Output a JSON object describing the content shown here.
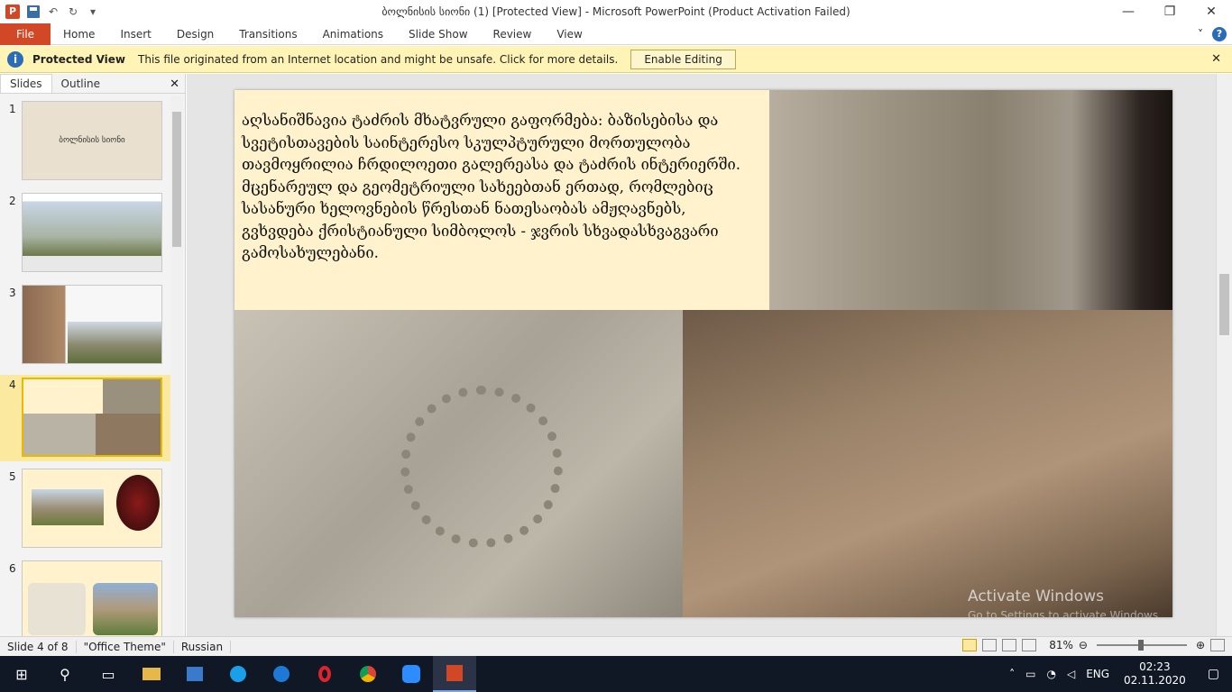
{
  "window": {
    "title": "ბოლნისის სიონი (1) [Protected View]  -  Microsoft PowerPoint (Product Activation Failed)",
    "app_letter": "P",
    "controls": {
      "minimize": "—",
      "restore": "❐",
      "close": "✕"
    }
  },
  "quick_access": {
    "undo": "↶",
    "redo": "↻",
    "customize": "▾"
  },
  "ribbon": {
    "file_label": "File",
    "tabs": [
      "Home",
      "Insert",
      "Design",
      "Transitions",
      "Animations",
      "Slide Show",
      "Review",
      "View"
    ],
    "collapse": "˅",
    "help": "?"
  },
  "protected_view": {
    "title": "Protected View",
    "message": "This file originated from an Internet location and might be unsafe. Click for more details.",
    "button": "Enable Editing",
    "close": "✕",
    "icon": "i"
  },
  "left_pane": {
    "tabs": [
      "Slides",
      "Outline"
    ],
    "close": "✕",
    "slide_numbers": [
      "1",
      "2",
      "3",
      "4",
      "5",
      "6"
    ],
    "slide1_title": "ბოლნისის სიონი",
    "selected_index": 4
  },
  "slide": {
    "text": "აღსანიშნავია ტაძრის მხატვრული გაფორმება: ბაზისებისა და სვეტისთავების საინტერესო სკულპტურული მორთულობა თავმოყრილია ჩრდილოეთი გალერეასა და ტაძრის ინტერიერში. მცენარეულ და გეომეტრიული სახეებთან ერთად, რომლებიც სასანური ხელოვნების წრესთან ნათესაობას ამჟღავნებს, გვხვდება ქრისტიანული სიმბოლოს - ჯვრის სხვადასხვაგვარი გამოსახულებანი."
  },
  "watermark": {
    "line1": "Activate Windows",
    "line2": "Go to Settings to activate Windows."
  },
  "status": {
    "slide_info": "Slide 4 of 8",
    "theme": "\"Office Theme\"",
    "language": "Russian",
    "zoom": "81%",
    "zoom_value": 81
  },
  "taskbar": {
    "language": "ENG",
    "time": "02:23",
    "date": "02.11.2020"
  },
  "colors": {
    "accent": "#d24726",
    "protected_bar": "#fff4b5",
    "slide_text_bg": "#fff2cc"
  }
}
